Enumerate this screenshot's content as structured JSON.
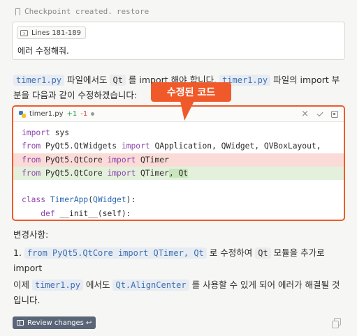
{
  "checkpoint": {
    "text": "Checkpoint created.",
    "restore": "restore"
  },
  "user_message": {
    "context_chip": "Lines 181-189",
    "text": "에러 수정해줘."
  },
  "intro": {
    "code1": "timer1.py",
    "t1": " 파일에서도 ",
    "code2": "Qt",
    "t2": " 를 import 해야 합니다. ",
    "code3": "timer1.py",
    "t3": " 파일의 import 부",
    "line2": "분을 다음과 같이 수정하겠습니다:"
  },
  "callout": {
    "label": "수정된 코드"
  },
  "code_block": {
    "filename": "timer1.py",
    "added": "+1",
    "removed": "-1",
    "lines": {
      "l1_kw": "import",
      "l1_rest": " sys",
      "l2_kw1": "from",
      "l2_mod": " PyQt5.QtWidgets ",
      "l2_kw2": "import",
      "l2_rest": " QApplication, QWidget, QVBoxLayout,",
      "l3_kw1": "from",
      "l3_mod": " PyQt5.QtCore ",
      "l3_kw2": "import",
      "l3_rest": " QTimer",
      "l4_kw1": "from",
      "l4_mod": " PyQt5.QtCore ",
      "l4_kw2": "import",
      "l4_rest": " QTimer",
      "l4_hl": ", Qt",
      "l6_kw": "class",
      "l6_name": " TimerApp",
      "l6_paren": "(",
      "l6_base": "QWidget",
      "l6_end": "):",
      "l7_indent": "    ",
      "l7_kw": "def",
      "l7_rest": " __init__(self):"
    }
  },
  "changes": {
    "heading": "변경사항:",
    "item_num": "1. ",
    "item_code": "from PyQt5.QtCore import QTimer, Qt",
    "item_t1": " 로 수정하여 ",
    "item_code2": "Qt",
    "item_t2": " 모듈을 추가로",
    "item_line2": "import"
  },
  "conclusion": {
    "t0": "이제 ",
    "code1": "timer1.py",
    "t1": " 에서도 ",
    "code2": "Qt.AlignCenter",
    "t2": " 를 사용할 수 있게 되어 에러가 해결될 것",
    "line2": "입니다."
  },
  "review_button": {
    "label": "Review changes ↩"
  },
  "colors": {
    "accent": "#f05a2a",
    "added": "#2e9e4c",
    "removed": "#d04a3a"
  }
}
